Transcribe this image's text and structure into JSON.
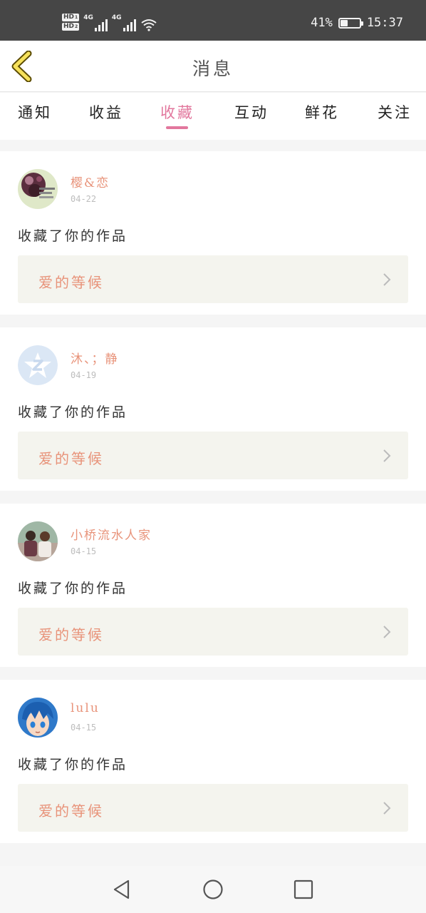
{
  "status_bar": {
    "hd1": "HD",
    "hd1_sub": "1",
    "hd2": "HD",
    "hd2_sub": "2",
    "net1": "4G",
    "net2": "4G",
    "battery_text": "41%",
    "battery_level": 0.41,
    "time": "15:37"
  },
  "header": {
    "title": "消息",
    "back_icon": "chevron-left-icon"
  },
  "tabs": [
    {
      "label": "通知"
    },
    {
      "label": "收益"
    },
    {
      "label": "收藏"
    },
    {
      "label": "互动"
    },
    {
      "label": "鲜花"
    },
    {
      "label": "关注"
    }
  ],
  "active_tab": "收藏",
  "colors": {
    "accent_pink": "#e2779d",
    "name_orange": "#e8937a",
    "work_bg": "#f4f4ee",
    "statusbar_bg": "#464646"
  },
  "messages": [
    {
      "user": "樱&恋",
      "date": "04-22",
      "action": "收藏了你的作品",
      "work_title": "爱的等候",
      "avatar": "avatar-photo-dark-flowers"
    },
    {
      "user": "沐、；静",
      "date": "04-19",
      "action": "收藏了你的作品",
      "work_title": "爱的等候",
      "avatar": "avatar-default-star"
    },
    {
      "user": "小桥流水人家",
      "date": "04-15",
      "action": "收藏了你的作品",
      "work_title": "爱的等候",
      "avatar": "avatar-photo-couple"
    },
    {
      "user": "lulu",
      "date": "04-15",
      "action": "收藏了你的作品",
      "work_title": "爱的等候",
      "avatar": "avatar-anime-blue-hair"
    }
  ],
  "nav_bar": {
    "back": "triangle-back-icon",
    "home": "circle-home-icon",
    "recents": "square-recents-icon"
  }
}
